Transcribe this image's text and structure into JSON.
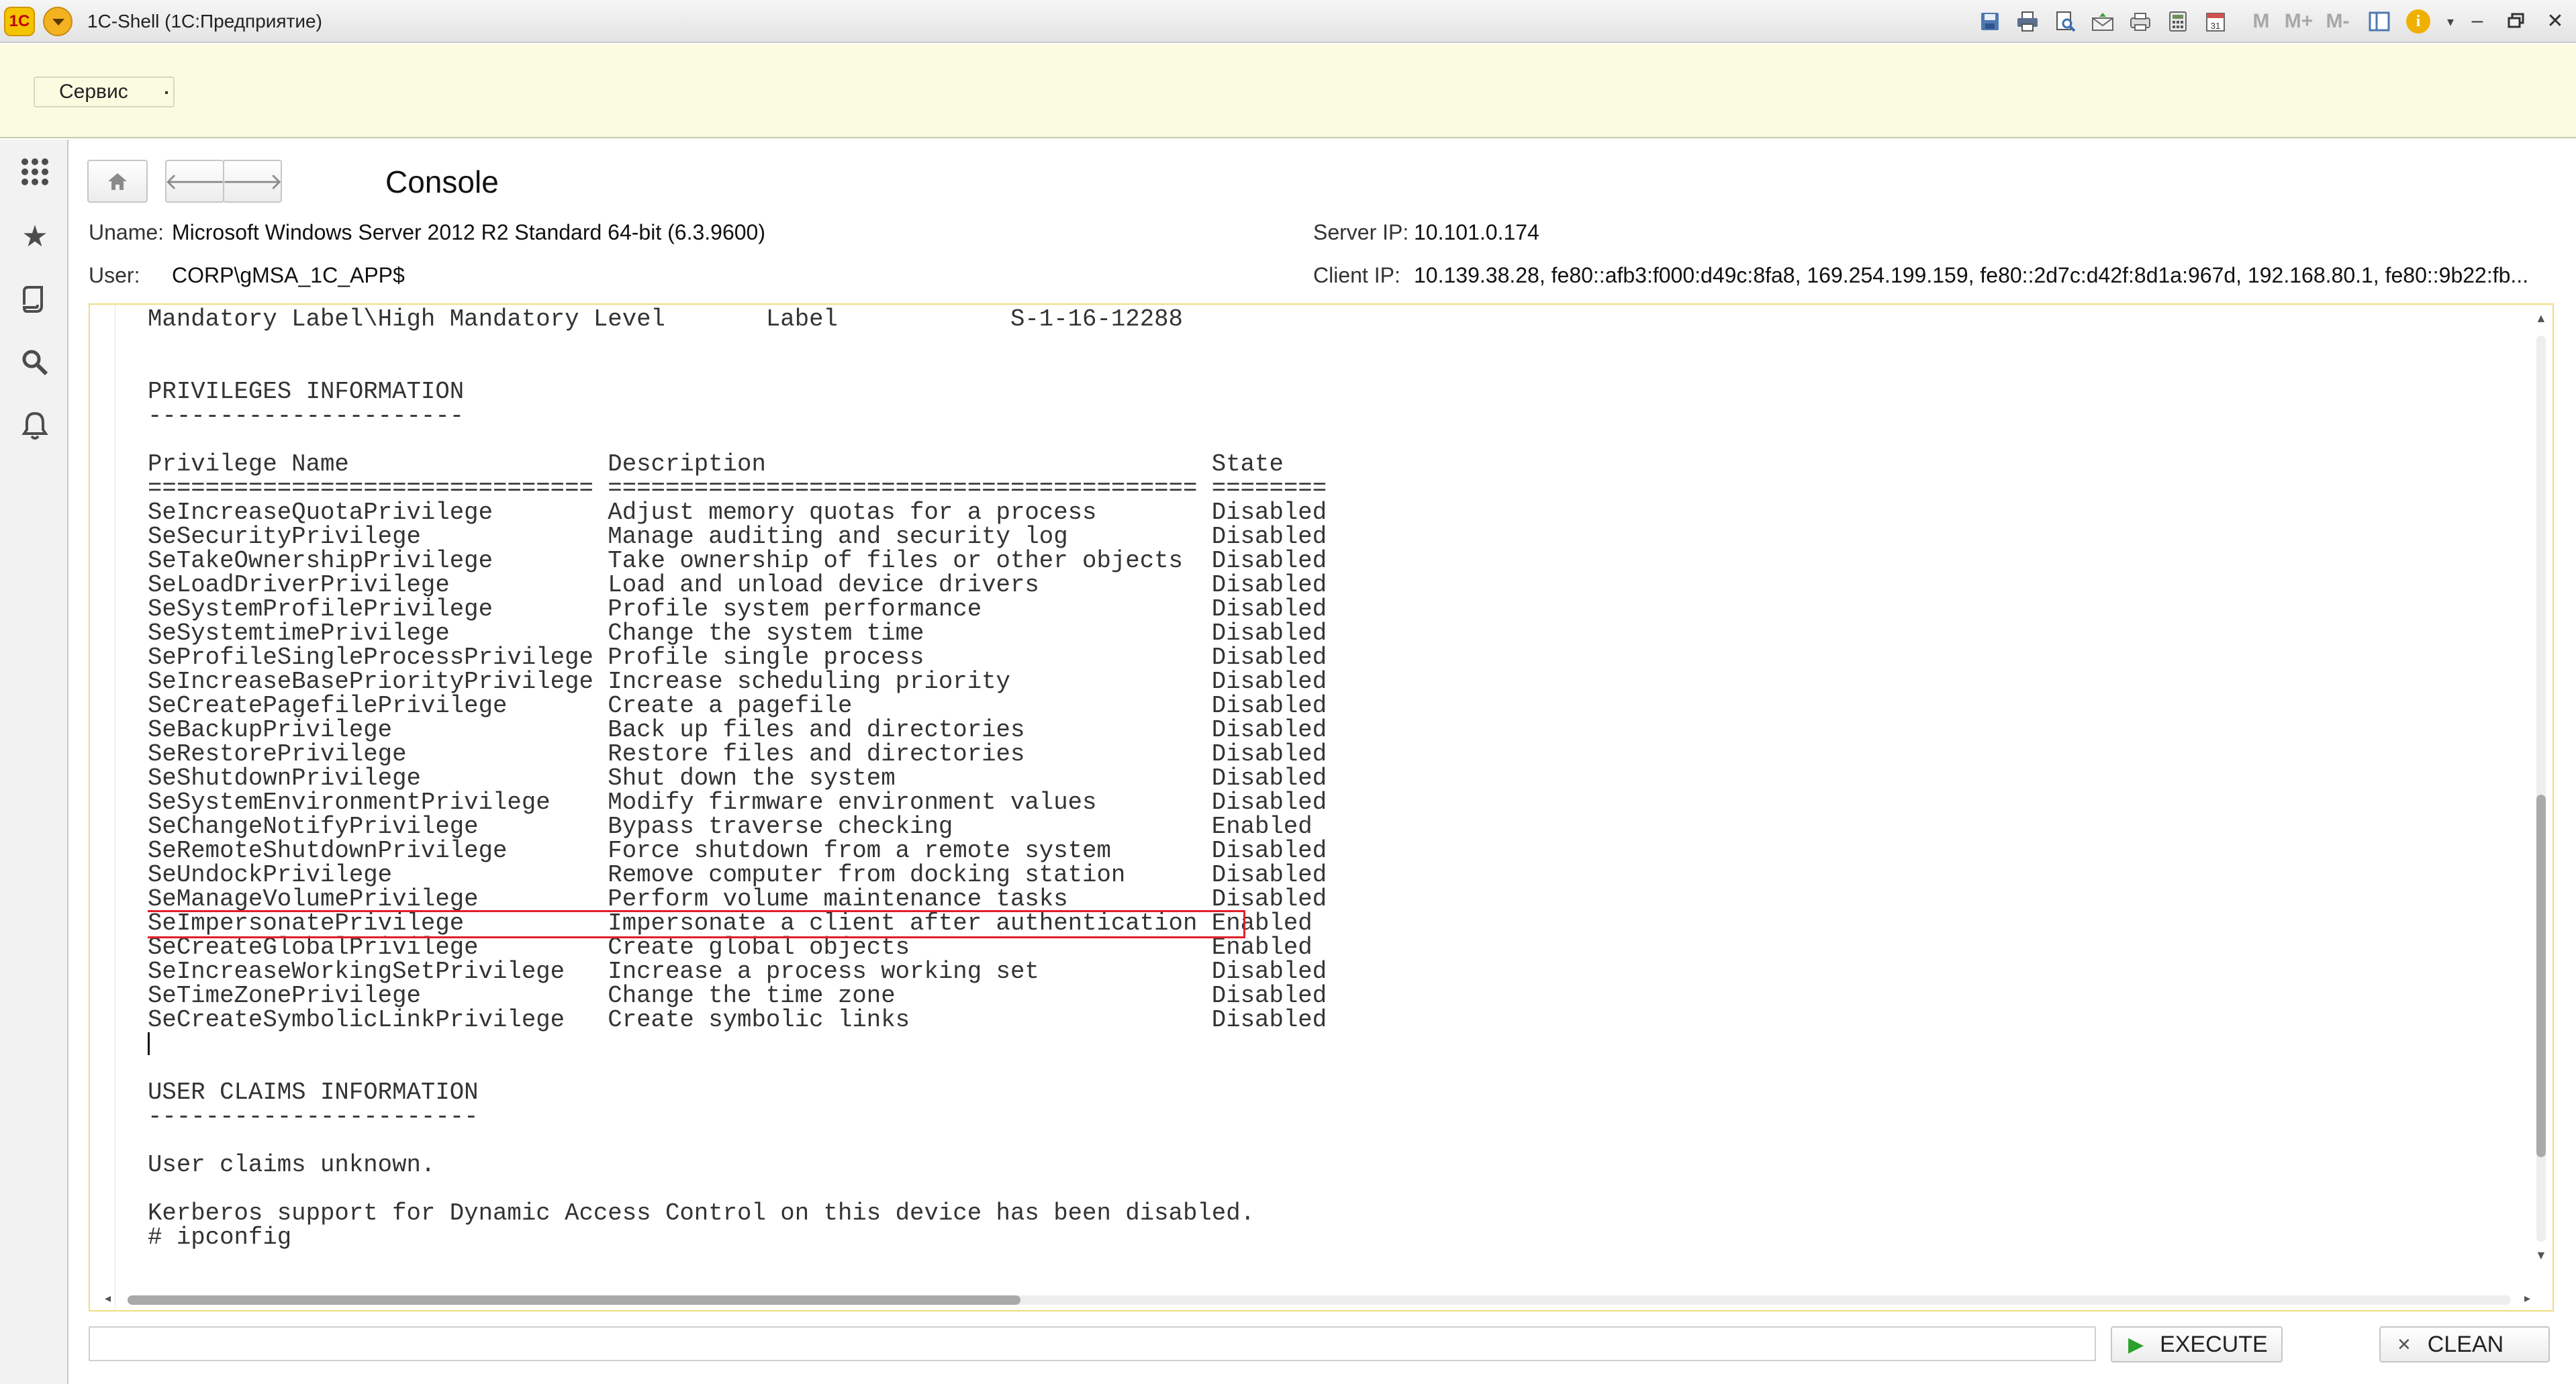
{
  "window": {
    "title": "1C-Shell  (1С:Предприятие)",
    "logo_text": "1С"
  },
  "toolbar": {
    "icons": [
      "save-icon",
      "print-icon",
      "print-preview-icon",
      "email-icon",
      "printer-icon",
      "calculator-icon",
      "calendar-icon",
      "memory-icon",
      "memory-plus-icon",
      "memory-minus-icon",
      "panels-icon",
      "info-icon",
      "dropdown-icon"
    ],
    "memory_labels": [
      "M",
      "M+",
      "M-"
    ],
    "calendar_day": "31",
    "info_symbol": "i"
  },
  "command_bar": {
    "service_label": "Сервис"
  },
  "sidebar": {
    "icons": [
      "apps-grid-icon",
      "favorites-star-icon",
      "history-icon",
      "search-icon",
      "notifications-bell-icon"
    ]
  },
  "main": {
    "page_title": "Console",
    "uname_label": "Uname:",
    "uname_value": "Microsoft Windows Server 2012 R2 Standard 64-bit (6.3.9600)",
    "user_label": "User:",
    "user_value": "CORP\\gMSA_1C_APP$",
    "server_ip_label": "Server IP:",
    "server_ip_value": "10.101.0.174",
    "client_ip_label": "Client IP:",
    "client_ip_value": "10.139.38.28, fe80::afb3:f000:d49c:8fa8, 169.254.199.159, fe80::2d7c:d42f:8d1a:967d, 192.168.80.1, fe80::9b22:fb..."
  },
  "console": {
    "lines": [
      "Mandatory Label\\High Mandatory Level       Label            S-1-16-12288",
      "",
      "",
      "PRIVILEGES INFORMATION",
      "----------------------",
      "",
      "Privilege Name                  Description                               State",
      "=============================== ========================================= ========",
      "SeIncreaseQuotaPrivilege        Adjust memory quotas for a process        Disabled",
      "SeSecurityPrivilege             Manage auditing and security log          Disabled",
      "SeTakeOwnershipPrivilege        Take ownership of files or other objects  Disabled",
      "SeLoadDriverPrivilege           Load and unload device drivers            Disabled",
      "SeSystemProfilePrivilege        Profile system performance                Disabled",
      "SeSystemtimePrivilege           Change the system time                    Disabled",
      "SeProfileSingleProcessPrivilege Profile single process                    Disabled",
      "SeIncreaseBasePriorityPrivilege Increase scheduling priority              Disabled",
      "SeCreatePagefilePrivilege       Create a pagefile                         Disabled",
      "SeBackupPrivilege               Back up files and directories             Disabled",
      "SeRestorePrivilege              Restore files and directories             Disabled",
      "SeShutdownPrivilege             Shut down the system                      Disabled",
      "SeSystemEnvironmentPrivilege    Modify firmware environment values        Disabled",
      "SeChangeNotifyPrivilege         Bypass traverse checking                  Enabled",
      "SeRemoteShutdownPrivilege       Force shutdown from a remote system       Disabled",
      "SeUndockPrivilege               Remove computer from docking station      Disabled",
      "SeManageVolumePrivilege         Perform volume maintenance tasks          Disabled",
      "SeImpersonatePrivilege          Impersonate a client after authentication Enabled",
      "SeCreateGlobalPrivilege         Create global objects                     Enabled",
      "SeIncreaseWorkingSetPrivilege   Increase a process working set            Disabled",
      "SeTimeZonePrivilege             Change the time zone                      Disabled",
      "SeCreateSymbolicLinkPrivilege   Create symbolic links                     Disabled",
      "",
      "",
      "USER CLAIMS INFORMATION",
      "-----------------------",
      "",
      "User claims unknown.",
      "",
      "Kerberos support for Dynamic Access Control on this device has been disabled.",
      "# ipconfig"
    ],
    "highlighted_line": 25,
    "cursor_line": 30
  },
  "command": {
    "input_value": "",
    "execute_label": "EXECUTE",
    "clean_label": "CLEAN"
  },
  "colors": {
    "command_bar_bg": "#fbfbe0",
    "console_border": "#f0dc80",
    "highlight": "#e0202a",
    "execute_icon": "#2aa12a"
  }
}
